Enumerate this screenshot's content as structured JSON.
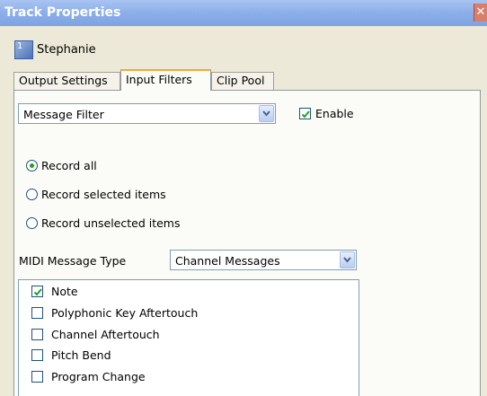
{
  "window": {
    "title": "Track Properties",
    "close_glyph": "✕"
  },
  "track": {
    "number": "1",
    "name": "Stephanie"
  },
  "tabs": [
    {
      "label": "Output Settings",
      "active": false
    },
    {
      "label": "Input Filters",
      "active": true
    },
    {
      "label": "Clip Pool",
      "active": false
    }
  ],
  "filter": {
    "selected": "Message Filter",
    "enable_label": "Enable",
    "enabled": true
  },
  "record_options": [
    {
      "label": "Record all",
      "selected": true
    },
    {
      "label": "Record selected items",
      "selected": false
    },
    {
      "label": "Record unselected items",
      "selected": false
    }
  ],
  "midi": {
    "label": "MIDI Message Type",
    "selected": "Channel Messages"
  },
  "message_list": [
    {
      "label": "Note",
      "checked": true
    },
    {
      "label": "Polyphonic Key Aftertouch",
      "checked": false
    },
    {
      "label": "Channel Aftertouch",
      "checked": false
    },
    {
      "label": "Pitch Bend",
      "checked": false
    },
    {
      "label": "Program Change",
      "checked": false
    }
  ],
  "colors": {
    "title_bar": "#8eb0ea",
    "active_tab_accent": "#f3a83c",
    "radio_dot": "#21a121",
    "check_mark": "#21a121"
  }
}
